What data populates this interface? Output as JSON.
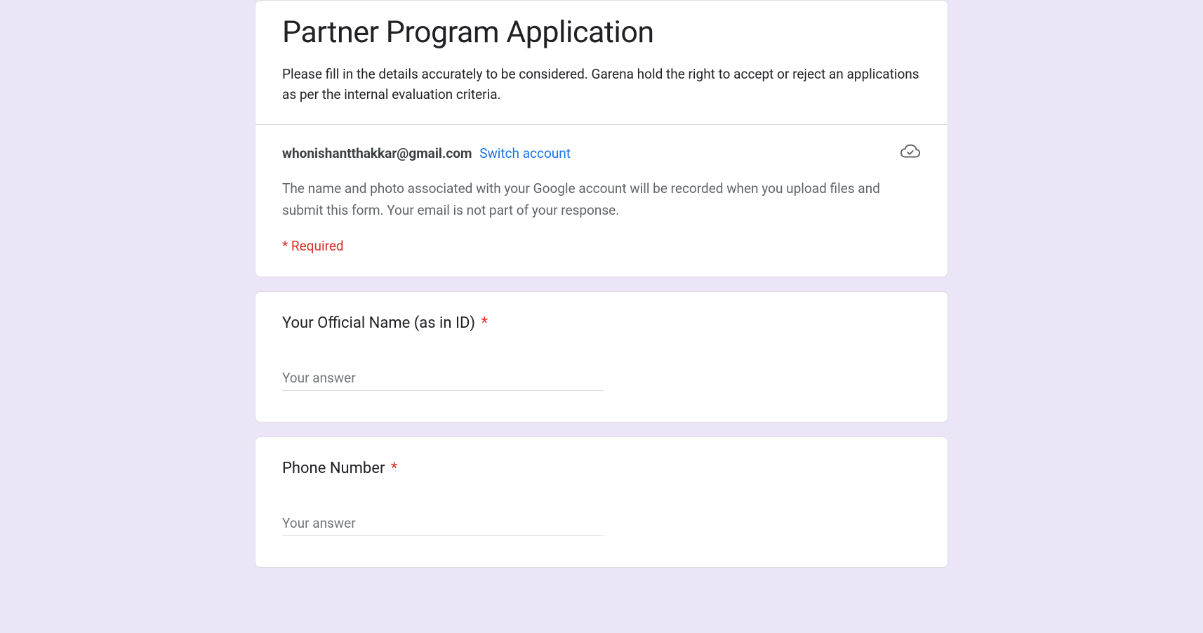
{
  "form": {
    "title": "Partner Program Application",
    "description": "Please fill in the details accurately to be considered. Garena hold the right to accept or reject an applications as per the internal evaluation criteria."
  },
  "account": {
    "email": "whonishantthakkar@gmail.com",
    "switch_label": "Switch account",
    "note": "The name and photo associated with your Google account will be recorded when you upload files and submit this form. Your email is not part of your response.",
    "required_label": "* Required"
  },
  "questions": [
    {
      "label": "Your Official Name (as in ID)",
      "required": true,
      "placeholder": "Your answer"
    },
    {
      "label": "Phone Number",
      "required": true,
      "placeholder": "Your answer"
    }
  ],
  "asterisk": "*"
}
